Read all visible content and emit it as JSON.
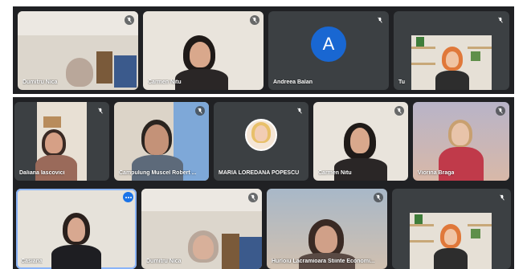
{
  "top_row": [
    {
      "name": "Dumitru Nica",
      "muted": true
    },
    {
      "name": "Carmen Nitu",
      "muted": true
    },
    {
      "name": "Andreea Balan",
      "muted": true,
      "avatar_letter": "A"
    },
    {
      "name": "Tu",
      "muted": true
    }
  ],
  "middle_row": [
    {
      "name": "Daliana Iascovici",
      "muted": true
    },
    {
      "name": "Campulung Muscel Robert ...",
      "muted": true
    },
    {
      "name": "MARIA LOREDANA POPESCU",
      "muted": true
    },
    {
      "name": "Carmen Nitu",
      "muted": true
    },
    {
      "name": "Viorina Braga",
      "muted": true
    }
  ],
  "bottom_row": [
    {
      "name": "Casiana",
      "muted": false
    },
    {
      "name": "Dumitru Nica",
      "muted": true
    },
    {
      "name": "Hurloiu Lacramioara Stiinte Economi...",
      "muted": true
    },
    {
      "name": "",
      "muted": true
    }
  ],
  "colors": {
    "tile_bg": "#3c4043",
    "strip_bg": "#202124",
    "avatar_blue": "#1967d2",
    "active_outline": "#8ab4f8"
  }
}
